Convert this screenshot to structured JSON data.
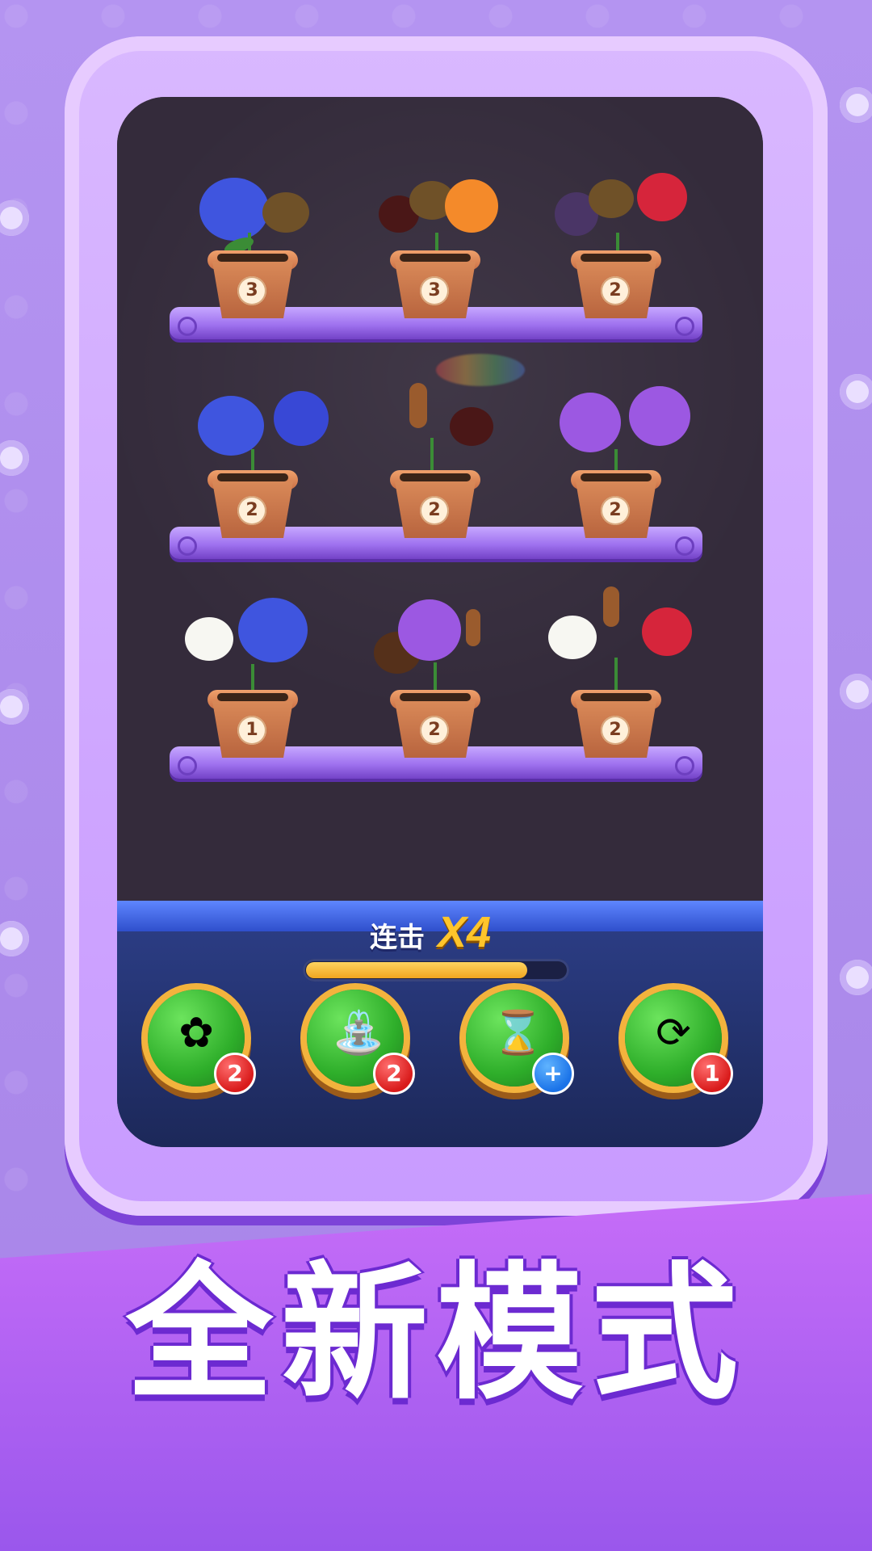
{
  "game": {
    "combo_label": "连击",
    "combo_multiplier": "X4",
    "combo_progress": 0.85,
    "shelves": [
      {
        "pots": [
          {
            "count": "3"
          },
          {
            "count": "3"
          },
          {
            "count": "2"
          }
        ]
      },
      {
        "pots": [
          {
            "count": "2"
          },
          {
            "count": "2"
          },
          {
            "count": "2"
          }
        ]
      },
      {
        "pots": [
          {
            "count": "1"
          },
          {
            "count": "2"
          },
          {
            "count": "2"
          }
        ]
      }
    ],
    "boosters": [
      {
        "icon": "flower-bundle-icon",
        "badge": "2"
      },
      {
        "icon": "watering-can-icon",
        "badge": "2"
      },
      {
        "icon": "hourglass-icon",
        "badge": "+"
      },
      {
        "icon": "shuffle-icon",
        "badge": "1"
      }
    ]
  },
  "promo": {
    "headline": "全新模式"
  },
  "colors": {
    "background": "#a985ea",
    "frame": "#c89bff",
    "panel": "#2d3f89",
    "progress": "#f0a51f",
    "booster_green": "#2eae2a",
    "badge_red": "#d91b1b",
    "badge_blue": "#1b73e8"
  }
}
